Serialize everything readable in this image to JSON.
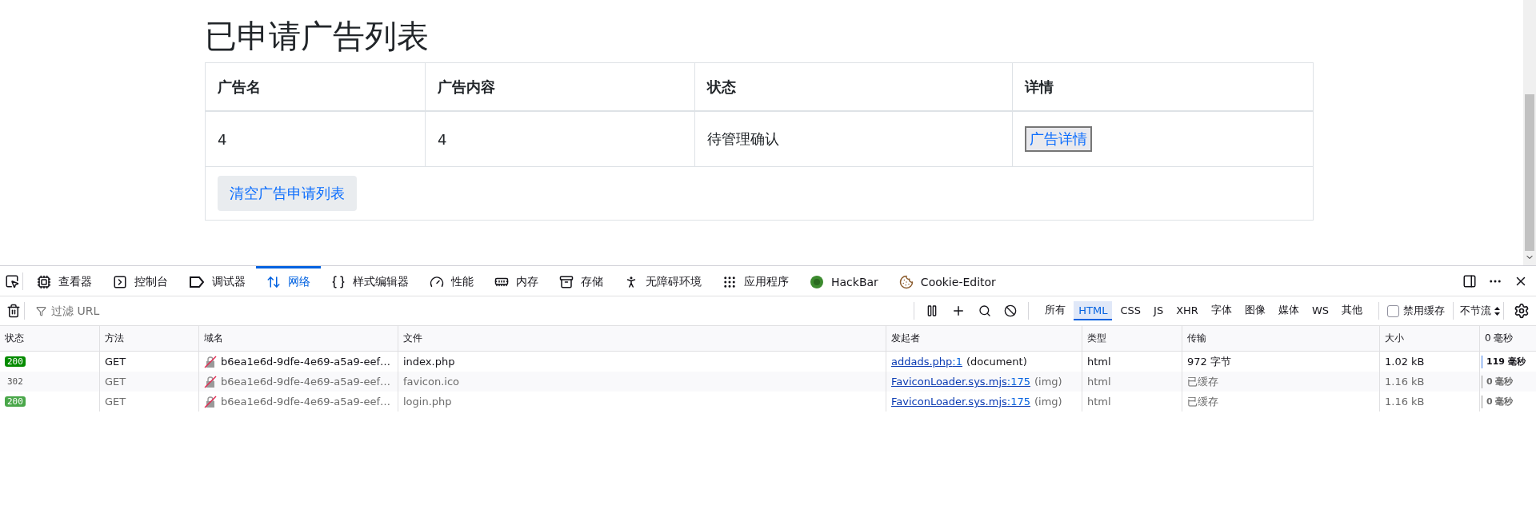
{
  "page": {
    "title": "已申请广告列表",
    "table": {
      "columns": [
        "广告名",
        "广告内容",
        "状态",
        "详情"
      ],
      "rows": [
        {
          "name": "4",
          "content": "4",
          "status": "待管理确认",
          "action": "广告详情"
        }
      ],
      "clear_button": "清空广告申请列表"
    }
  },
  "devtools": {
    "tabs": [
      {
        "label": "查看器",
        "selected": false
      },
      {
        "label": "控制台",
        "selected": false
      },
      {
        "label": "调试器",
        "selected": false
      },
      {
        "label": "网络",
        "selected": true
      },
      {
        "label": "样式编辑器",
        "selected": false
      },
      {
        "label": "性能",
        "selected": false
      },
      {
        "label": "内存",
        "selected": false
      },
      {
        "label": "存储",
        "selected": false
      },
      {
        "label": "无障碍环境",
        "selected": false
      },
      {
        "label": "应用程序",
        "selected": false
      },
      {
        "label": "HackBar",
        "selected": false
      },
      {
        "label": "Cookie-Editor",
        "selected": false
      }
    ],
    "filter": {
      "placeholder": "过滤 URL"
    },
    "type_filters": [
      {
        "label": "所有",
        "selected": false
      },
      {
        "label": "HTML",
        "selected": true
      },
      {
        "label": "CSS",
        "selected": false
      },
      {
        "label": "JS",
        "selected": false
      },
      {
        "label": "XHR",
        "selected": false
      },
      {
        "label": "字体",
        "selected": false
      },
      {
        "label": "图像",
        "selected": false
      },
      {
        "label": "媒体",
        "selected": false
      },
      {
        "label": "WS",
        "selected": false
      },
      {
        "label": "其他",
        "selected": false
      }
    ],
    "disable_cache": {
      "label": "禁用缓存",
      "checked": false
    },
    "throttle": "不节流",
    "columns": [
      "状态",
      "方法",
      "域名",
      "文件",
      "发起者",
      "类型",
      "传输",
      "大小",
      "0 毫秒"
    ],
    "requests": [
      {
        "status": "200",
        "kind": "ok",
        "cached": false,
        "method": "GET",
        "domain": "b6ea1e6d-9dfe-4e69-a5a9-eef…",
        "file": "index.php",
        "initiator_file": "addads.php",
        "initiator_line": ":1",
        "initiator_note": "(document)",
        "type": "html",
        "transferred": "972 字节",
        "size": "1.02 kB",
        "time": "119 毫秒"
      },
      {
        "status": "302",
        "kind": "redirect",
        "cached": true,
        "method": "GET",
        "domain": "b6ea1e6d-9dfe-4e69-a5a9-eef…",
        "file": "favicon.ico",
        "initiator_file": "FaviconLoader.sys.mjs",
        "initiator_line": ":175",
        "initiator_note": "(img)",
        "type": "html",
        "transferred": "已缓存",
        "size": "1.16 kB",
        "time": "0 毫秒"
      },
      {
        "status": "200",
        "kind": "ok",
        "cached": true,
        "method": "GET",
        "domain": "b6ea1e6d-9dfe-4e69-a5a9-eef…",
        "file": "login.php",
        "initiator_file": "FaviconLoader.sys.mjs",
        "initiator_line": ":175",
        "initiator_note": "(img)",
        "type": "html",
        "transferred": "已缓存",
        "size": "1.16 kB",
        "time": "0 毫秒"
      }
    ]
  }
}
